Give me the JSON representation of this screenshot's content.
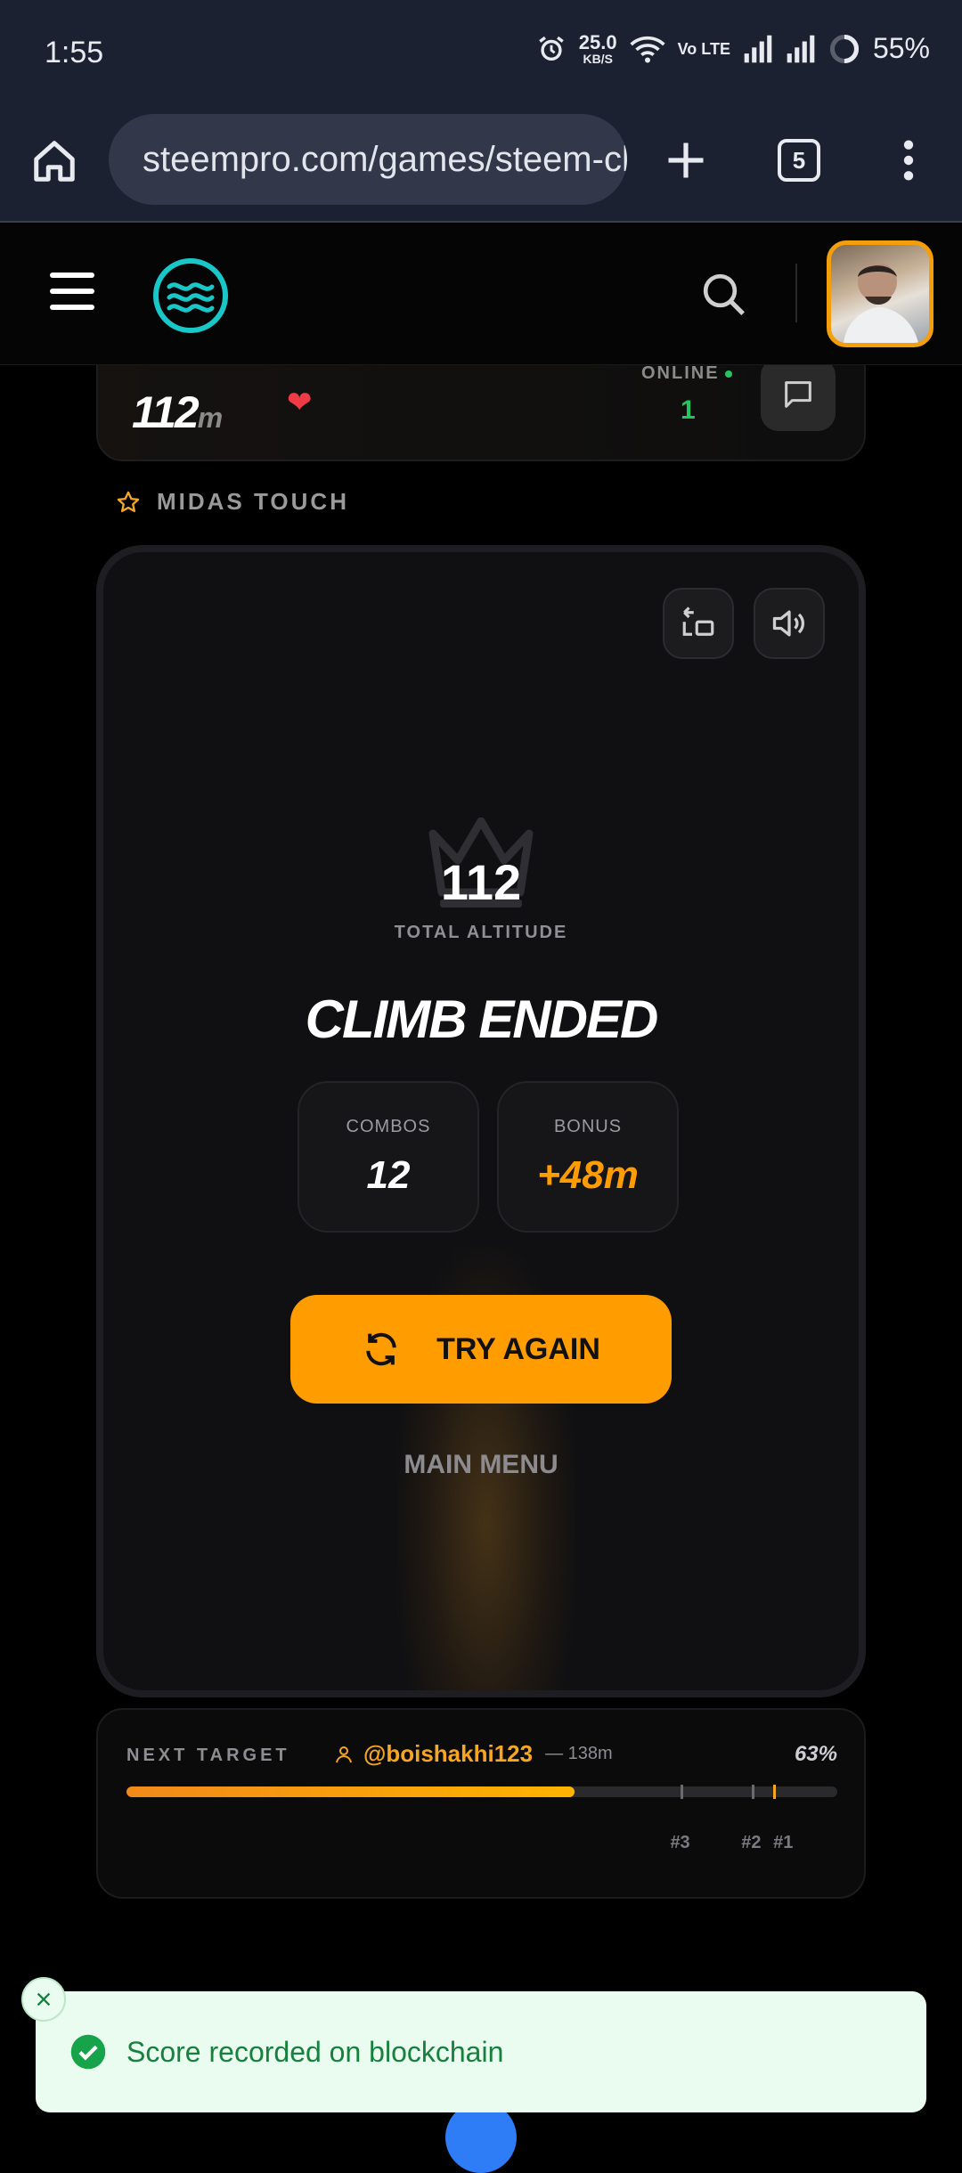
{
  "status_bar": {
    "time": "1:55",
    "net_speed_value": "25.0",
    "net_speed_unit": "KB/S",
    "volte_label": "Vo LTE",
    "battery": "55%",
    "icons": [
      "alarm-icon",
      "wifi-icon",
      "signal-icon",
      "signal-icon",
      "battery-icon"
    ]
  },
  "browser": {
    "url": "steempro.com/games/steem-climb",
    "tab_count": "5",
    "icons": [
      "home-icon",
      "site-settings-icon",
      "new-tab-icon",
      "tabs-icon",
      "more-menu-icon"
    ]
  },
  "site_header": {
    "icons": [
      "hamburger-menu-icon",
      "steem-logo",
      "search-icon",
      "user-avatar"
    ]
  },
  "score_card": {
    "best_value": "112",
    "best_unit": "m",
    "online_label": "ONLINE",
    "online_count": "1"
  },
  "game_mode": {
    "label": "MIDAS TOUCH"
  },
  "game_over": {
    "total_altitude": "112",
    "total_altitude_label": "TOTAL ALTITUDE",
    "title": "CLIMB ENDED",
    "combos_label": "COMBOS",
    "combos_value": "12",
    "bonus_label": "BONUS",
    "bonus_value": "+48m",
    "try_again_label": "TRY AGAIN",
    "main_menu_label": "MAIN MENU"
  },
  "next_target": {
    "label": "NEXT TARGET",
    "username": "@boishakhi123",
    "distance": "— 138m",
    "percent_text": "63%",
    "progress_fraction": 0.63,
    "ranks": [
      {
        "label": "#3",
        "fraction": 0.78
      },
      {
        "label": "#2",
        "fraction": 0.88
      },
      {
        "label": "#1",
        "fraction": 0.91
      }
    ]
  },
  "toast": {
    "message": "Score recorded on blockchain"
  },
  "colors": {
    "accent": "#ff9d00",
    "online_green": "#22c55e",
    "toast_bg": "#eafbf0",
    "toast_text": "#17803d",
    "heart": "#ef3b45"
  }
}
